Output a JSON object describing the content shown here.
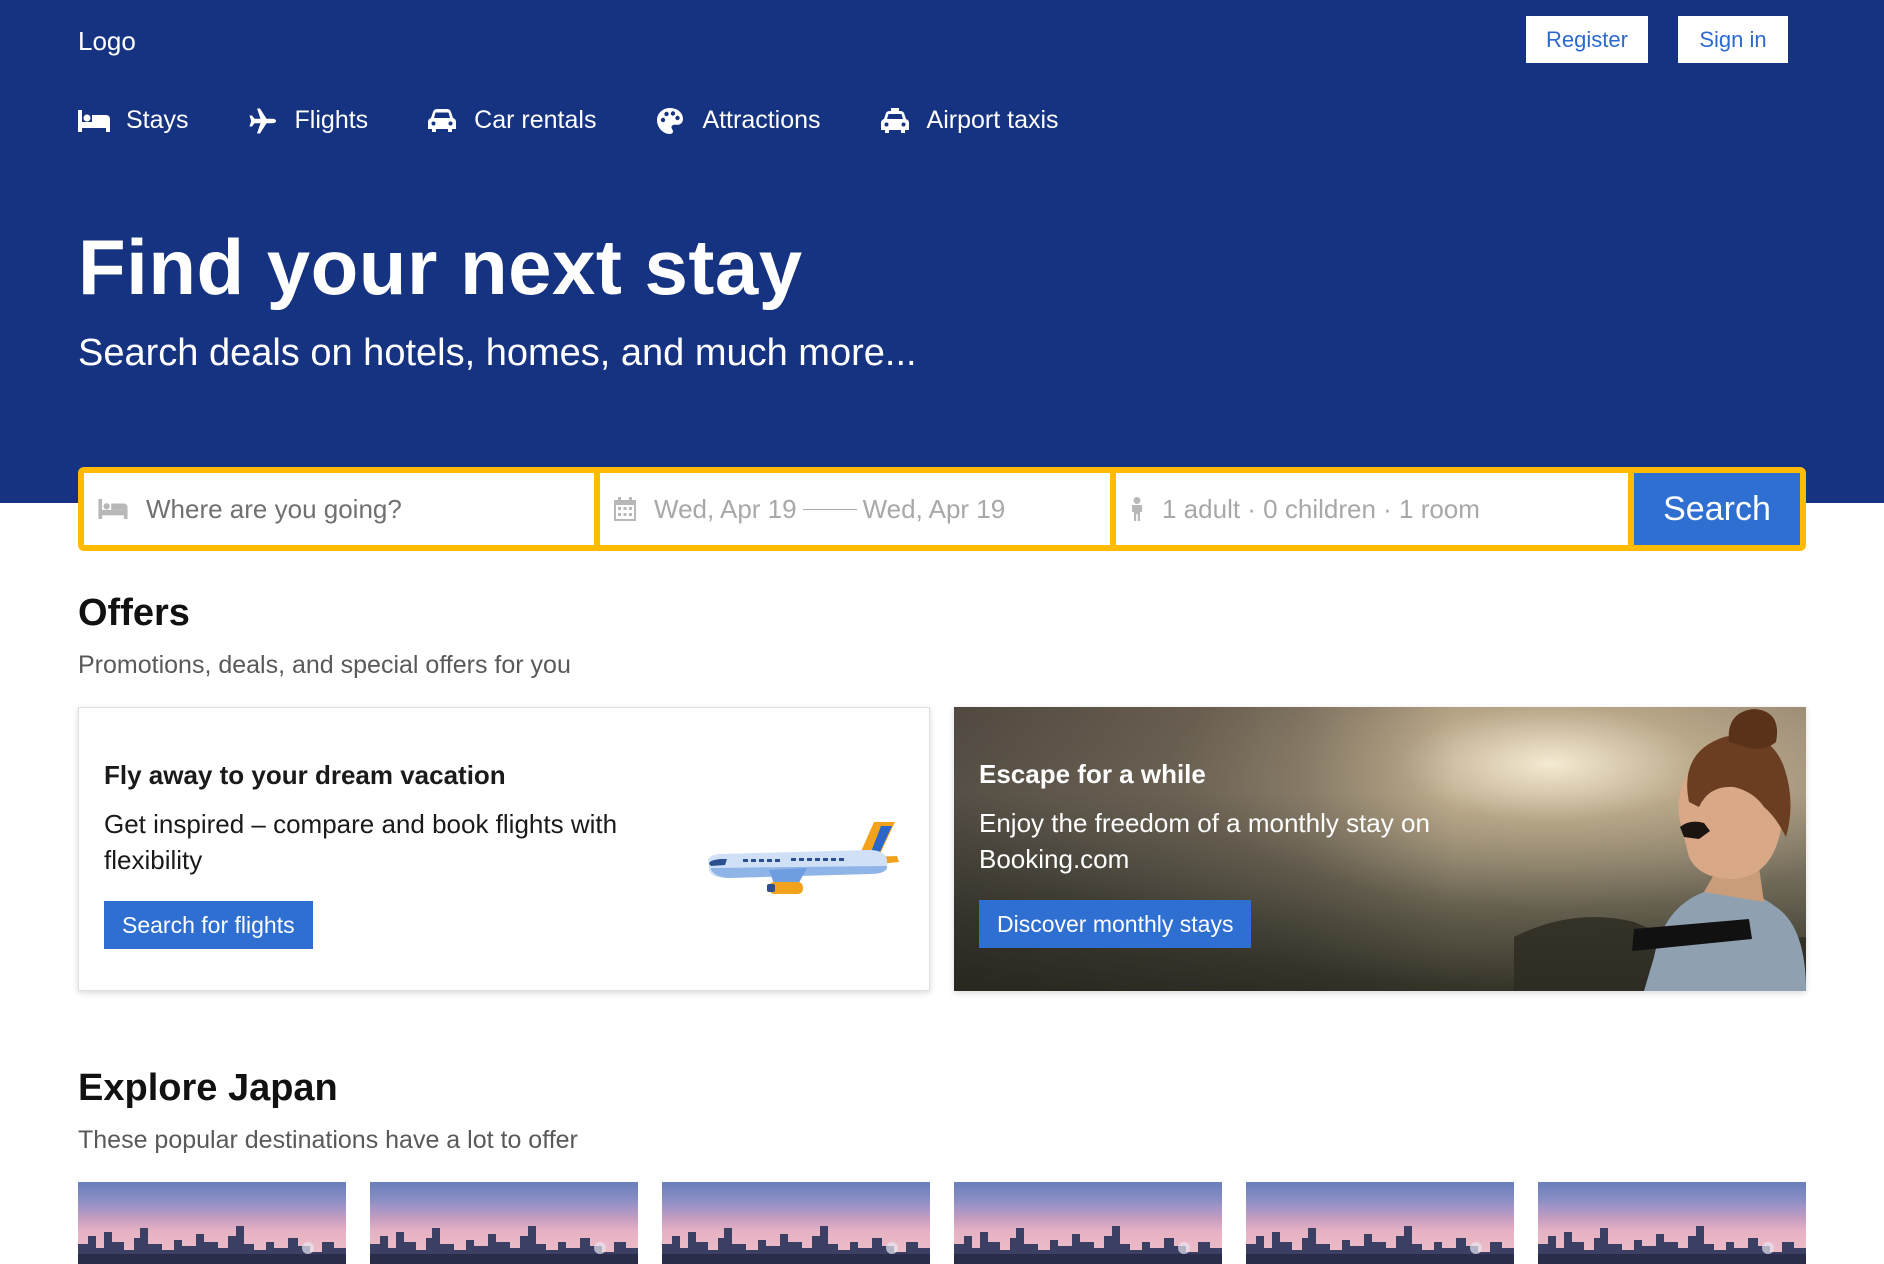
{
  "header": {
    "logo": "Logo",
    "register_label": "Register",
    "signin_label": "Sign in",
    "nav": [
      {
        "label": "Stays",
        "icon": "bed-icon"
      },
      {
        "label": "Flights",
        "icon": "plane-icon"
      },
      {
        "label": "Car rentals",
        "icon": "car-icon"
      },
      {
        "label": "Attractions",
        "icon": "palette-icon"
      },
      {
        "label": "Airport taxis",
        "icon": "taxi-icon"
      }
    ]
  },
  "hero": {
    "title": "Find your next stay",
    "subtitle": "Search deals on hotels, homes, and much more..."
  },
  "search": {
    "destination_placeholder": "Where are you going?",
    "check_in": "Wed, Apr 19",
    "check_out": "Wed, Apr 19",
    "guests": "1 adult · 0 children · 1 room",
    "button": "Search"
  },
  "offers": {
    "title": "Offers",
    "subtitle": "Promotions, deals, and special offers for you",
    "cards": [
      {
        "title": "Fly away to your dream vacation",
        "body": "Get inspired – compare and book flights with flexibility",
        "button": "Search for flights"
      },
      {
        "title": "Escape for a while",
        "body": "Enjoy the freedom of a monthly stay on Booking.com",
        "button": "Discover monthly stays"
      }
    ]
  },
  "explore": {
    "title": "Explore Japan",
    "subtitle": "These popular destinations have a lot to offer"
  },
  "colors": {
    "header_bg": "#163381",
    "accent": "#febb02",
    "primary_button": "#2e6fd1"
  }
}
